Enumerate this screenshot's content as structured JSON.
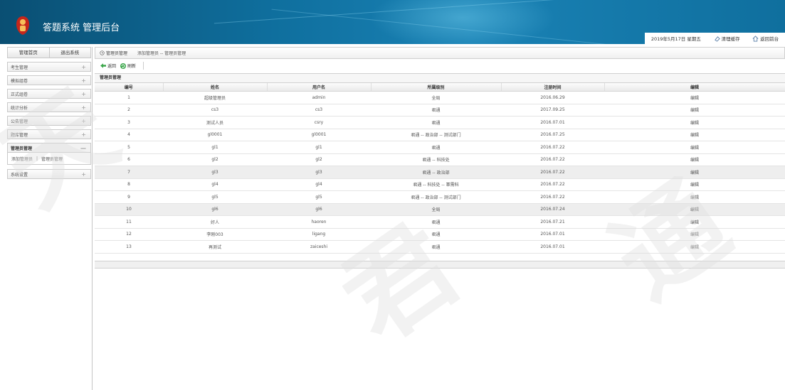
{
  "app": {
    "title": "答题系统 管理后台"
  },
  "header_bar": {
    "date": "2019年5月17日 星期五",
    "clear_cache": "清理缓存",
    "back_front": "返回前台"
  },
  "sidebar": {
    "home": "管理首页",
    "logout": "退出系统",
    "items": [
      {
        "label": "考生管理",
        "sign": "+"
      },
      {
        "label": "模拟组卷",
        "sign": "+"
      },
      {
        "label": "正式组卷",
        "sign": "+"
      },
      {
        "label": "统计分析",
        "sign": "+"
      },
      {
        "label": "公告管理",
        "sign": "+"
      },
      {
        "label": "题库管理",
        "sign": "+"
      },
      {
        "label": "管理员管理",
        "sign": "—"
      }
    ],
    "submenu": {
      "add": "添加管理员",
      "sep": "|",
      "manage": "管理员管理"
    },
    "settings": {
      "label": "系统设置",
      "sign": "+"
    }
  },
  "breadcrumb": {
    "tab": "管理员管理",
    "path": "添加管理员 -- 管理员管理"
  },
  "toolbar": {
    "back": "返回",
    "refresh": "刷新"
  },
  "section": {
    "title": "管理员管理"
  },
  "table": {
    "headers": [
      "编号",
      "姓名",
      "用户名",
      "所属级别",
      "注册时间",
      "编辑"
    ],
    "rows": [
      {
        "id": "1",
        "name": "超级管理员",
        "username": "admin",
        "level": "全局",
        "date": "2016.06.29",
        "edit": "编辑"
      },
      {
        "id": "2",
        "name": "cs3",
        "username": "cs3",
        "level": "君通",
        "date": "2017.09.25",
        "edit": "编辑"
      },
      {
        "id": "3",
        "name": "测试人员",
        "username": "csry",
        "level": "君通",
        "date": "2016.07.01",
        "edit": "编辑"
      },
      {
        "id": "4",
        "name": "gl0001",
        "username": "gl0001",
        "level": "君通 -- 政治部 -- 测试部门",
        "date": "2016.07.25",
        "edit": "编辑"
      },
      {
        "id": "5",
        "name": "gl1",
        "username": "gl1",
        "level": "君通",
        "date": "2016.07.22",
        "edit": "编辑"
      },
      {
        "id": "6",
        "name": "gl2",
        "username": "gl2",
        "level": "君通 -- 科技处",
        "date": "2016.07.22",
        "edit": "编辑"
      },
      {
        "id": "7",
        "name": "gl3",
        "username": "gl3",
        "level": "君通 -- 政治部",
        "date": "2016.07.22",
        "edit": "编辑"
      },
      {
        "id": "8",
        "name": "gl4",
        "username": "gl4",
        "level": "君通 -- 科技处 -- 軍需科",
        "date": "2016.07.22",
        "edit": "编辑"
      },
      {
        "id": "9",
        "name": "gl5",
        "username": "gl5",
        "level": "君通 -- 政治部 -- 测试部门",
        "date": "2016.07.22",
        "edit": "编辑"
      },
      {
        "id": "10",
        "name": "gl6",
        "username": "gl6",
        "level": "全局",
        "date": "2016.07.24",
        "edit": "编辑"
      },
      {
        "id": "11",
        "name": "好人",
        "username": "haoren",
        "level": "君通",
        "date": "2016.07.21",
        "edit": "编辑"
      },
      {
        "id": "12",
        "name": "李刚003",
        "username": "ligang",
        "level": "君通",
        "date": "2016.07.01",
        "edit": "编辑"
      },
      {
        "id": "13",
        "name": "再测试",
        "username": "zaiceshi",
        "level": "君通",
        "date": "2016.07.01",
        "edit": "编辑"
      }
    ]
  },
  "colors": {
    "header": "#0f6f9e",
    "refresh_icon": "#3aa64a",
    "back_icon": "#3aa64a"
  }
}
